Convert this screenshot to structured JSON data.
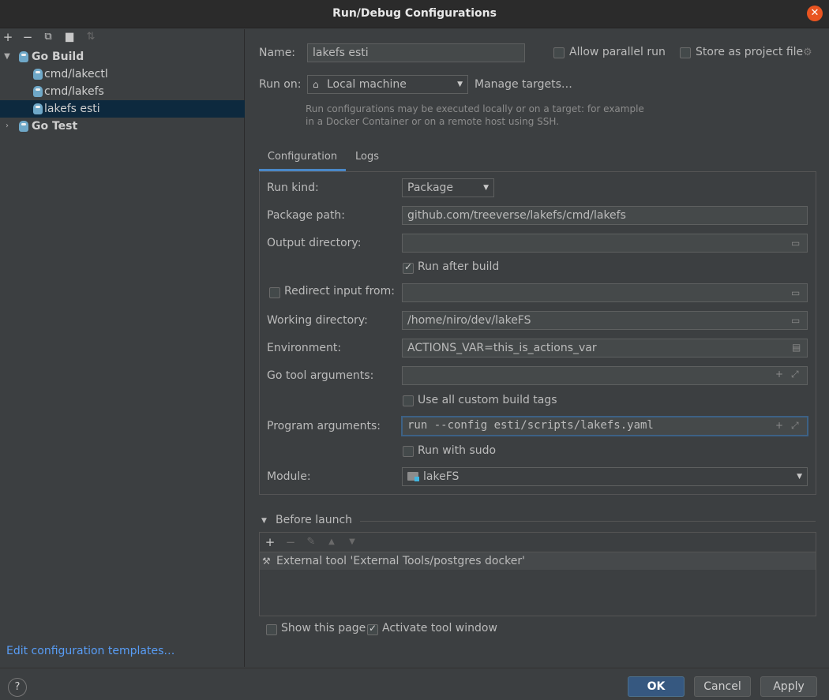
{
  "window": {
    "title": "Run/Debug Configurations"
  },
  "tree": {
    "toolbar": [
      "plus-icon",
      "minus-icon",
      "copy-icon",
      "new-folder-icon",
      "sort-icon"
    ],
    "groups": [
      {
        "label": "Go Build",
        "expanded": true,
        "items": [
          "cmd/lakectl",
          "cmd/lakefs",
          "lakefs esti"
        ]
      },
      {
        "label": "Go Test",
        "expanded": false,
        "items": []
      }
    ],
    "selected": "lakefs esti"
  },
  "edit_templates": "Edit configuration templates…",
  "form": {
    "name_label": "Name:",
    "name_value": "lakefs esti",
    "allow_parallel_label": "Allow parallel run",
    "store_as_project_label": "Store as project file",
    "run_on_label": "Run on:",
    "run_on_value": "Local machine",
    "manage_targets": "Manage targets…",
    "hint_line1": "Run configurations may be executed locally or on a target: for example",
    "hint_line2": "in a Docker Container or on a remote host using SSH."
  },
  "tabs": [
    "Configuration",
    "Logs"
  ],
  "config": {
    "run_kind_label": "Run kind:",
    "run_kind_value": "Package",
    "package_path_label": "Package path:",
    "package_path_value": "github.com/treeverse/lakefs/cmd/lakefs",
    "output_dir_label": "Output directory:",
    "output_dir_value": "",
    "run_after_build_label": "Run after build",
    "redirect_label": "Redirect input from:",
    "redirect_value": "",
    "working_dir_label": "Working directory:",
    "working_dir_value": "/home/niro/dev/lakeFS",
    "environment_label": "Environment:",
    "environment_value": "ACTIONS_VAR=this_is_actions_var",
    "go_tool_args_label": "Go tool arguments:",
    "go_tool_args_value": "",
    "custom_tags_label": "Use all custom build tags",
    "program_args_label": "Program arguments:",
    "program_args_value": "run --config esti/scripts/lakefs.yaml",
    "run_sudo_label": "Run with sudo",
    "module_label": "Module:",
    "module_value": "lakeFS"
  },
  "before_launch": {
    "title": "Before launch",
    "items": [
      "External tool 'External Tools/postgres docker'"
    ]
  },
  "footer": {
    "show_page_label": "Show this page",
    "activate_tool_label": "Activate tool window",
    "help": "?",
    "ok": "OK",
    "cancel": "Cancel",
    "apply": "Apply"
  }
}
